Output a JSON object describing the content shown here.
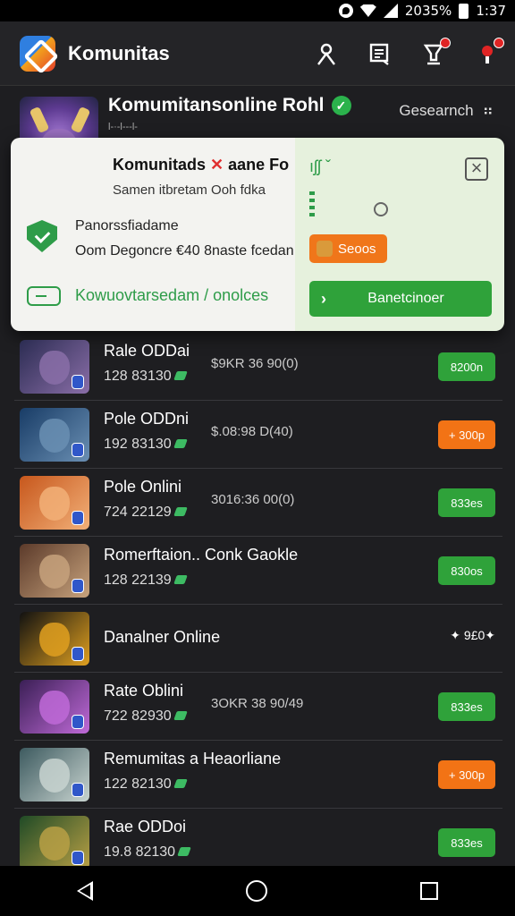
{
  "status": {
    "battery": "2035%",
    "time": "1:37"
  },
  "app": {
    "title": "Komunitas"
  },
  "hero": {
    "title": "Komumitansonline Rohl",
    "subtitle": "l-·-l---l-",
    "search_label": "Gesearnch"
  },
  "popup": {
    "title_a": "Komunitads",
    "title_x": "✕",
    "title_b": "aane Fo",
    "subtitle": "Samen itbretam Ooh fdka",
    "item1": "Panorssfiadame",
    "item2": "Oom Degoncre €40 8naste fcedan",
    "link": "Kowuovtarsedam / onolces",
    "right_icon": "ıʃʃ ˇ",
    "badge": "Seoos",
    "cta_arrow": "›",
    "cta_label": "Banetcinoer"
  },
  "list": [
    {
      "name": "Rale ODDai",
      "meta": "128 83130",
      "price": "$9KR 36 90(0)",
      "action": "8200n",
      "style": "green",
      "colors": [
        "#2b2c52",
        "#8a6ea8"
      ]
    },
    {
      "name": "Pole ODDni",
      "meta": "192 83130",
      "price": "$.08:98 D(40)",
      "action": "+ 300p",
      "style": "orange",
      "colors": [
        "#183c66",
        "#6a8fb3"
      ]
    },
    {
      "name": "Pole Onlini",
      "meta": "724 22129",
      "price": "3016:36 00(0)",
      "action": "833es",
      "style": "green",
      "colors": [
        "#c7571c",
        "#f2b078"
      ]
    },
    {
      "name": "Romerftaion.. Conk Gaokle",
      "meta": "128 22139",
      "price": "",
      "action": "830os",
      "style": "green",
      "colors": [
        "#5b3a2a",
        "#c7a27c"
      ]
    },
    {
      "name": "Danalner Online",
      "meta": "",
      "price": "",
      "action": "✦ 9£0✦",
      "style": "ghost",
      "colors": [
        "#111111",
        "#e0a020"
      ]
    },
    {
      "name": "Rate Oblini",
      "meta": "722 82930",
      "price": "3OKR 38 90/49",
      "action": "833es",
      "style": "green",
      "colors": [
        "#3a1f55",
        "#c06ad8"
      ]
    },
    {
      "name": "Remumitas a Heaorliane",
      "meta": "122 82130",
      "price": "",
      "action": "+ 300p",
      "style": "orange",
      "colors": [
        "#3d5a5f",
        "#c8d4d0"
      ]
    },
    {
      "name": "Rae ODDoi",
      "meta": "19.8 82130",
      "price": "",
      "action": "833es",
      "style": "green",
      "colors": [
        "#1f4a26",
        "#b9a045"
      ]
    }
  ]
}
